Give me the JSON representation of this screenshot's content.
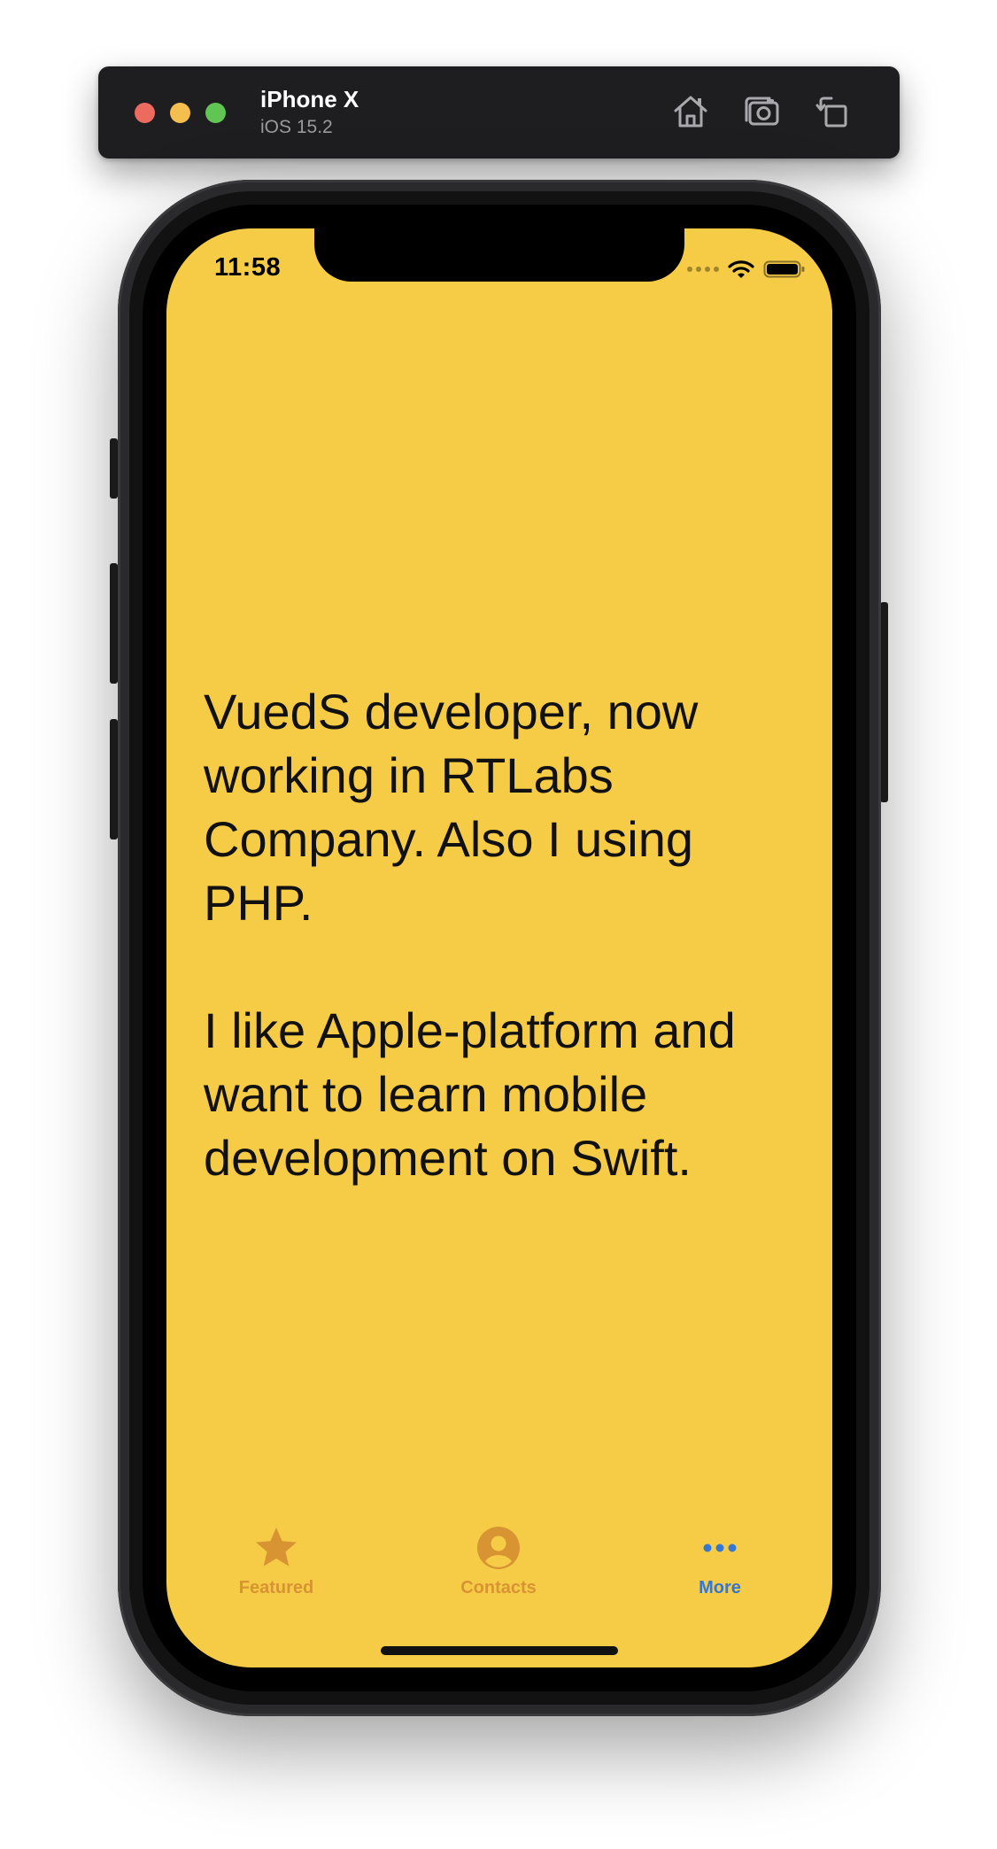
{
  "simulator": {
    "device_name": "iPhone X",
    "os_version": "iOS 15.2",
    "toolbar_buttons": [
      {
        "icon": "home-icon"
      },
      {
        "icon": "screenshot-icon"
      },
      {
        "icon": "rotate-icon"
      }
    ]
  },
  "status_bar": {
    "time": "11:58",
    "icons": [
      "cellular-signal-icon",
      "wifi-icon",
      "battery-icon"
    ]
  },
  "content": {
    "paragraphs": [
      "VuedS developer, now working in RTLabs Company. Also I using PHP.",
      "I like Apple-platform and want to learn mobile development on Swift."
    ]
  },
  "tab_bar": {
    "items": [
      {
        "label": "Featured",
        "icon": "star-icon",
        "selected": false
      },
      {
        "label": "Contacts",
        "icon": "person-circle-icon",
        "selected": false
      },
      {
        "label": "More",
        "icon": "ellipsis-icon",
        "selected": true
      }
    ]
  },
  "colors": {
    "screen_background": "#f6cc47",
    "tab_inactive": "#d89433",
    "tab_active": "#3477d4"
  }
}
